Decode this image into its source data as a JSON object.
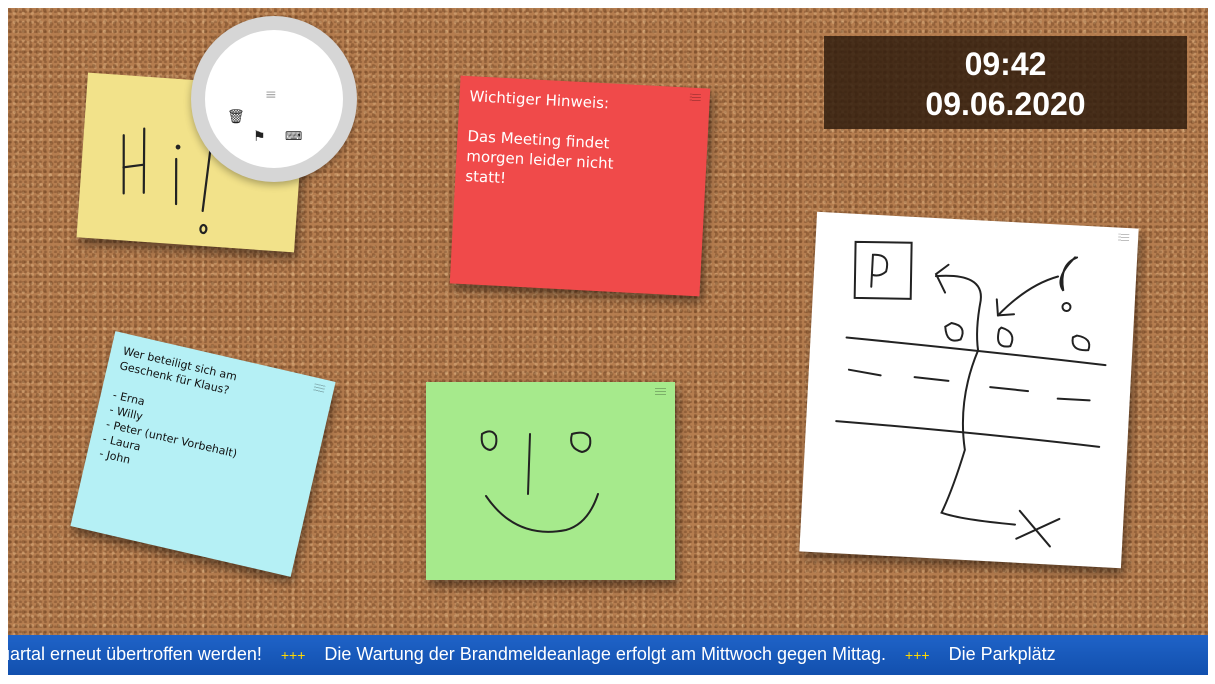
{
  "clock": {
    "time": "09:42",
    "date": "09.06.2020"
  },
  "notes": {
    "yellow": {
      "drawing": "Hi!",
      "color": "#f2e28a"
    },
    "red": {
      "text": "Wichtiger Hinweis:\n\nDas Meeting findet\nmorgen leider nicht\nstatt!",
      "color": "#f04a4a"
    },
    "blue": {
      "text": "Wer beteiligt sich am\nGeschenk für Klaus?\n\n- Erna\n- Willy\n- Peter (unter Vorbehalt)\n- Laura\n- John",
      "color": "#b5f0f5"
    },
    "green": {
      "drawing": "smiley face",
      "color": "#a6ea8c"
    },
    "white": {
      "drawing": "parking map sketch",
      "color": "#ffffff"
    }
  },
  "note_menu": {
    "icons": [
      "menu-icon",
      "trash-icon",
      "flag-icon",
      "keyboard-icon"
    ]
  },
  "ticker": {
    "items": [
      "uartal erneut übertroffen werden!",
      "Die Wartung der Brandmeldeanlage erfolgt am Mittwoch gegen Mittag.",
      "Die Parkplätz"
    ],
    "separator": "+++"
  },
  "colors": {
    "cork": "#b57d4f",
    "ticker": "#1a5cbf",
    "separator": "#ffd800",
    "clock_bg": "#32200f"
  }
}
